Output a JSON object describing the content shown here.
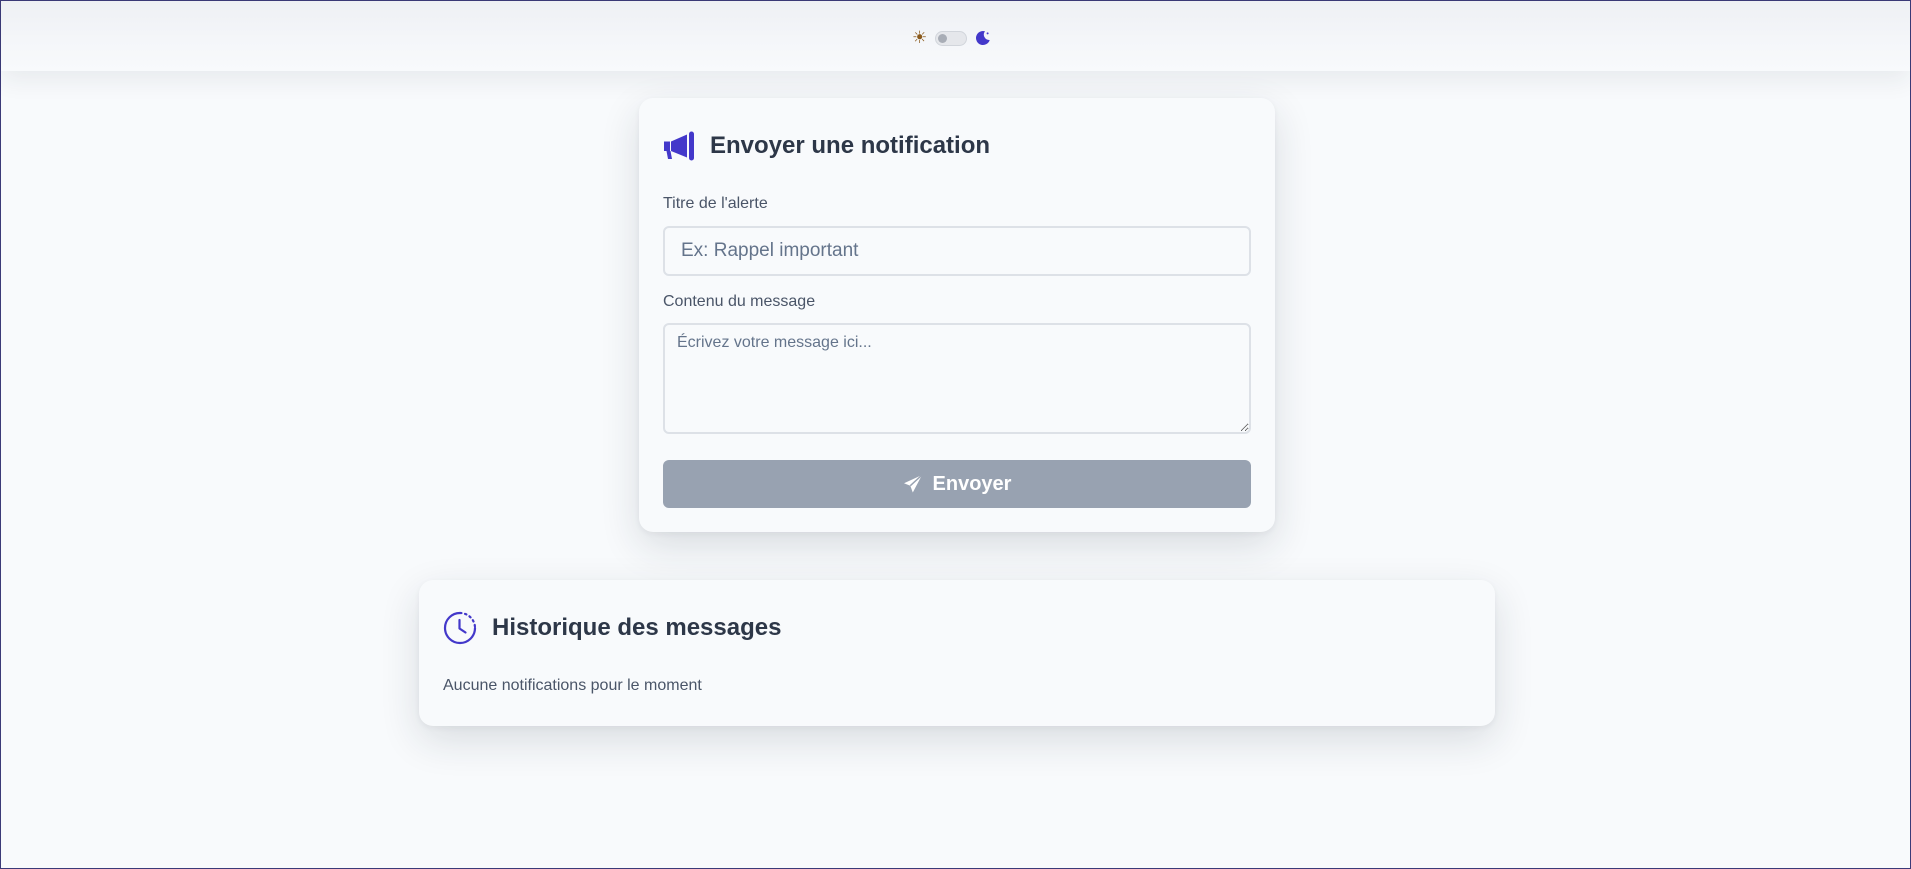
{
  "theme": {
    "sun_icon": "sun-icon",
    "moon_icon": "moon-icon",
    "dark_mode": false
  },
  "send_card": {
    "icon": "megaphone-icon",
    "title": "Envoyer une notification",
    "title_label": "Titre de l'alerte",
    "title_placeholder": "Ex: Rappel important",
    "title_value": "",
    "message_label": "Contenu du message",
    "message_placeholder": "Écrivez votre message ici...",
    "message_value": "",
    "send_icon": "paper-plane-icon",
    "send_label": "Envoyer"
  },
  "history_card": {
    "icon": "clock-history-icon",
    "title": "Historique des messages",
    "empty_text": "Aucune notifications pour le moment"
  },
  "colors": {
    "accent": "#4338ca",
    "button_disabled": "#98a2b1",
    "heading": "#2d3748",
    "background": "#f8fafc"
  }
}
